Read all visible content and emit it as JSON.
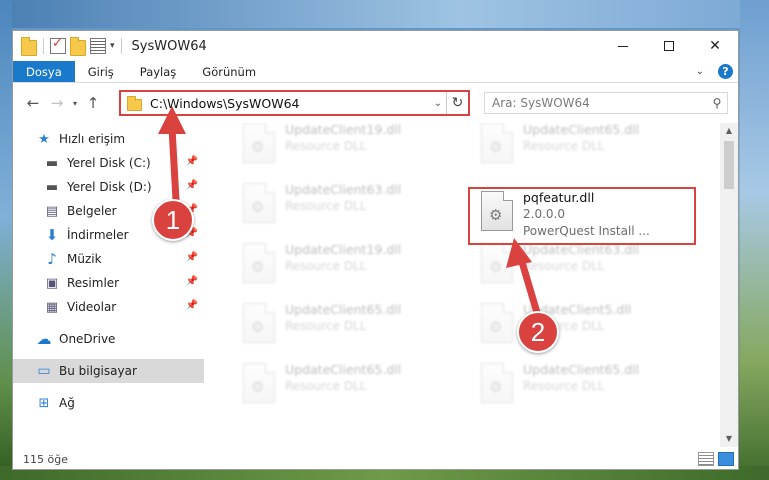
{
  "window": {
    "title": "SysWOW64"
  },
  "ribbon": {
    "tabs": [
      "Dosya",
      "Giriş",
      "Paylaş",
      "Görünüm"
    ],
    "help_label": "?"
  },
  "navbar": {
    "address": "C:\\Windows\\SysWOW64",
    "search_placeholder": "Ara: SysWOW64"
  },
  "sidebar": {
    "items": [
      {
        "label": "Hızlı erişim",
        "icon": "star-icon"
      },
      {
        "label": "Yerel Disk (C:)",
        "icon": "drive-icon"
      },
      {
        "label": "Yerel Disk (D:)",
        "icon": "drive-icon"
      },
      {
        "label": "Belgeler",
        "icon": "document-icon"
      },
      {
        "label": "İndirmeler",
        "icon": "download-icon"
      },
      {
        "label": "Müzik",
        "icon": "music-icon"
      },
      {
        "label": "Resimler",
        "icon": "pictures-icon"
      },
      {
        "label": "Videolar",
        "icon": "video-icon"
      },
      {
        "label": "OneDrive",
        "icon": "cloud-icon"
      },
      {
        "label": "Bu bilgisayar",
        "icon": "computer-icon"
      },
      {
        "label": "Ağ",
        "icon": "network-icon"
      }
    ]
  },
  "files": [
    {
      "name": "UpdateClient19.dll",
      "sub": "Resource DLL"
    },
    {
      "name": "UpdateClient65.dll",
      "sub": "Resource DLL"
    },
    {
      "name": "UpdateClient63.dll",
      "sub": "Resource DLL"
    },
    {
      "name": "pqfeatur.dll",
      "version": "2.0.0.0",
      "sub": "PowerQuest Install ..."
    },
    {
      "name": "UpdateClient19.dll",
      "sub": "Resource DLL"
    },
    {
      "name": "UpdateClient63.dll",
      "sub": "Resource DLL"
    },
    {
      "name": "UpdateClient65.dll",
      "sub": "Resource DLL"
    },
    {
      "name": "UpdateClient5.dll",
      "sub": "Resource DLL"
    },
    {
      "name": "UpdateClient65.dll",
      "sub": "Resource DLL"
    },
    {
      "name": "UpdateClient65.dll",
      "sub": "Resource DLL"
    }
  ],
  "status": {
    "count": "115 öğe"
  },
  "callouts": [
    "1",
    "2"
  ],
  "colors": {
    "accent": "#1979ca",
    "annotation": "#d9423f"
  }
}
